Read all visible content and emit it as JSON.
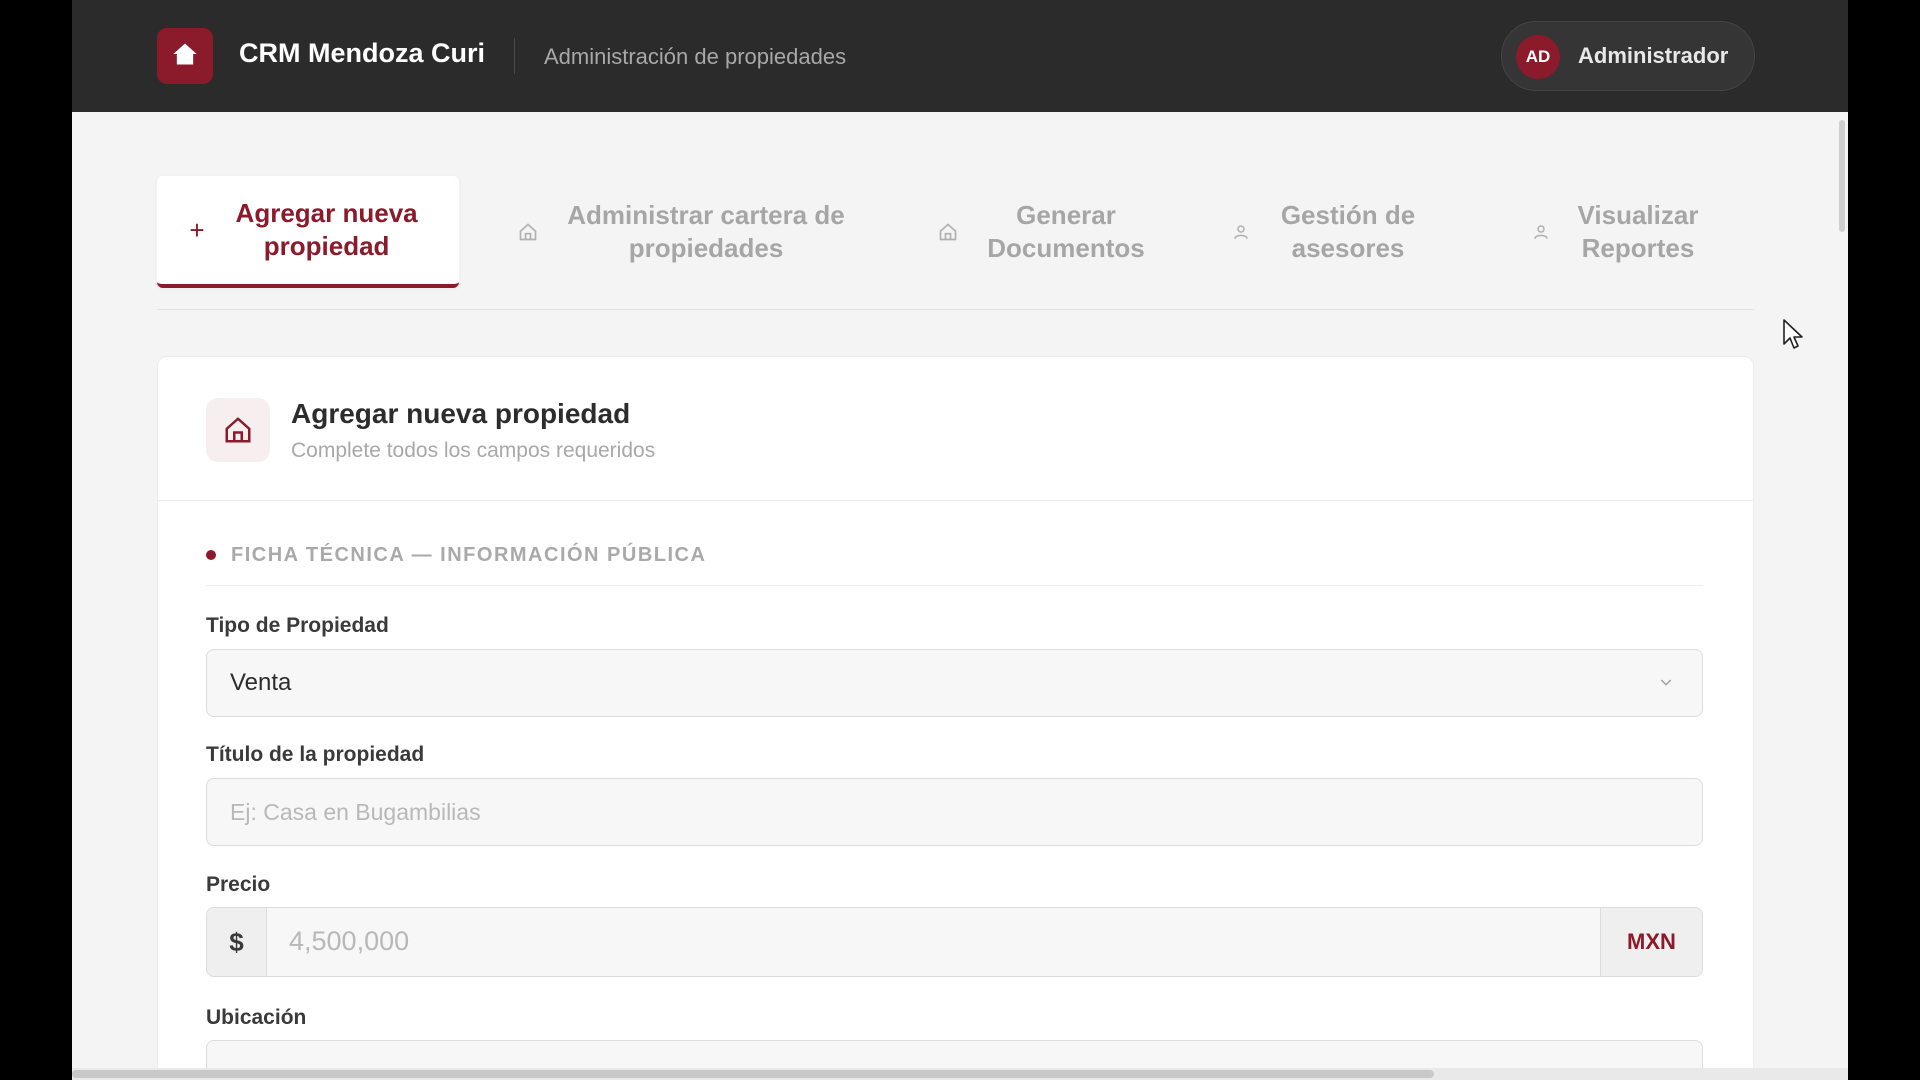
{
  "header": {
    "brand_name": "CRM Mendoza Curi",
    "section": "Administración de propiedades",
    "user": {
      "initials": "AD",
      "name": "Administrador"
    }
  },
  "tabs": [
    {
      "label": "Agregar nueva propiedad",
      "icon": "plus-icon",
      "active": true
    },
    {
      "label": "Administrar cartera de propiedades",
      "icon": "home-icon",
      "active": false
    },
    {
      "label": "Generar Documentos",
      "icon": "home-icon",
      "active": false
    },
    {
      "label": "Gestión de asesores",
      "icon": "user-icon",
      "active": false
    },
    {
      "label": "Visualizar Reportes",
      "icon": "user-icon",
      "active": false
    }
  ],
  "card": {
    "title": "Agregar nueva propiedad",
    "subtitle": "Complete todos los campos requeridos",
    "section_title": "FICHA TÉCNICA — INFORMACIÓN PÚBLICA",
    "fields": {
      "tipo": {
        "label": "Tipo de Propiedad",
        "value": "Venta"
      },
      "titulo": {
        "label": "Título de la propiedad",
        "placeholder": "Ej: Casa en Bugambilias"
      },
      "precio": {
        "label": "Precio",
        "prefix": "$",
        "placeholder": "4,500,000",
        "currency": "MXN"
      },
      "ubicacion": {
        "label": "Ubicación"
      }
    }
  },
  "colors": {
    "accent": "#8b1a2b",
    "header_bg": "#2b2b2b",
    "page_bg": "#f4f4f4"
  }
}
